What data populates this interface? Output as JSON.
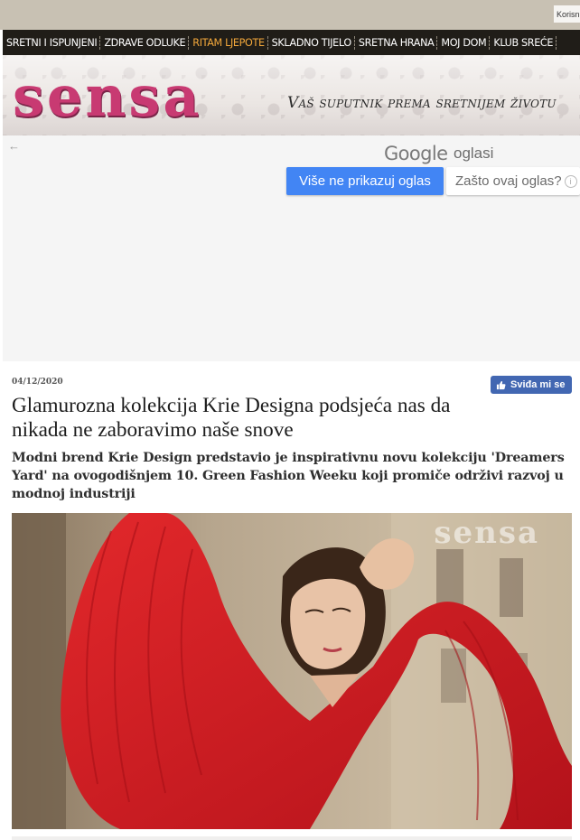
{
  "topbar": {
    "user_text": "Korisn"
  },
  "nav": {
    "items": [
      {
        "label": "SRETNI I ISPUNJENI",
        "active": false
      },
      {
        "label": "ZDRAVE ODLUKE",
        "active": false
      },
      {
        "label": "RITAM LJEPOTE",
        "active": true
      },
      {
        "label": "SKLADNO TIJELO",
        "active": false
      },
      {
        "label": "SRETNA HRANA",
        "active": false
      },
      {
        "label": "MOJ DOM",
        "active": false
      },
      {
        "label": "KLUB SREĆE",
        "active": false
      }
    ]
  },
  "header": {
    "logo": "sensa",
    "tagline": "Vaš suputnik prema sretnijem životu"
  },
  "ad": {
    "google_label": "Google",
    "oglasi_label": "oglasi",
    "stop_button": "Više ne prikazuj oglas",
    "why_button": "Zašto ovaj oglas?"
  },
  "article": {
    "date": "04/12/2020",
    "like_button": "Sviđa mi se",
    "title": "Glamurozna kolekcija Krie Designa podsjeća nas da nikada ne zaboravimo naše snove",
    "lead": "Modni brend Krie Design predstavio je inspirativnu novu kolekciju 'Dreamers Yard' na ovogodišnjem 10. Green Fashion Weeku koji promiče održivi razvoj u modnoj industriji",
    "photo_watermark": "sensa"
  },
  "colors": {
    "nav_bg": "#201d18",
    "nav_active": "#f3a83b",
    "logo": "#c83a72",
    "google_button": "#4285f4",
    "facebook": "#4267b2",
    "dress": "#d01a1e"
  }
}
